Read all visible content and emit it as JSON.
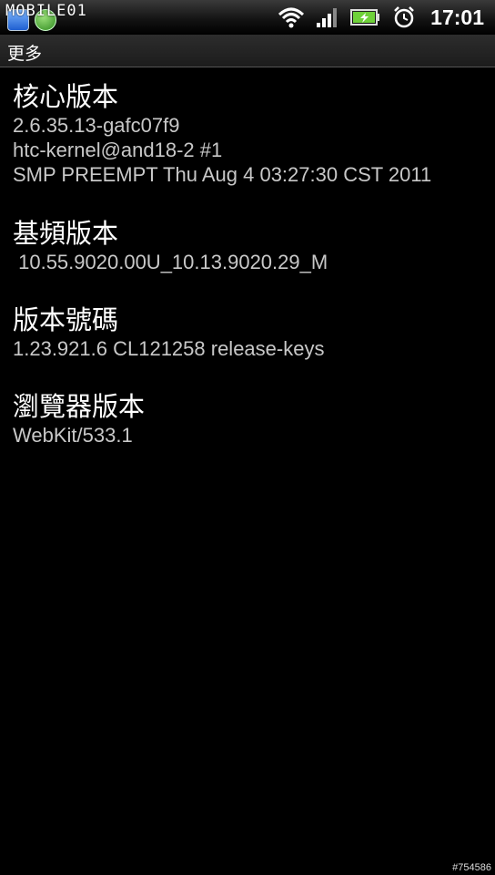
{
  "status_bar": {
    "watermark": "MOBILE01",
    "time": "17:01",
    "icons": [
      "notification-app-icon",
      "notification-security-icon",
      "wifi-icon",
      "signal-icon",
      "battery-charging-icon",
      "alarm-clock-icon"
    ],
    "battery_color": "#6fd13a"
  },
  "header": {
    "title": "更多"
  },
  "sections": [
    {
      "title": "核心版本",
      "lines": [
        "2.6.35.13-gafc07f9",
        "htc-kernel@and18-2 #1",
        "SMP PREEMPT Thu Aug 4 03:27:30 CST 2011"
      ]
    },
    {
      "title": "基頻版本",
      "lines": [
        " 10.55.9020.00U_10.13.9020.29_M"
      ]
    },
    {
      "title": "版本號碼",
      "lines": [
        "1.23.921.6 CL121258 release-keys"
      ]
    },
    {
      "title": "瀏覽器版本",
      "lines": [
        "WebKit/533.1"
      ]
    }
  ],
  "footer": {
    "image_id": "#754586"
  }
}
